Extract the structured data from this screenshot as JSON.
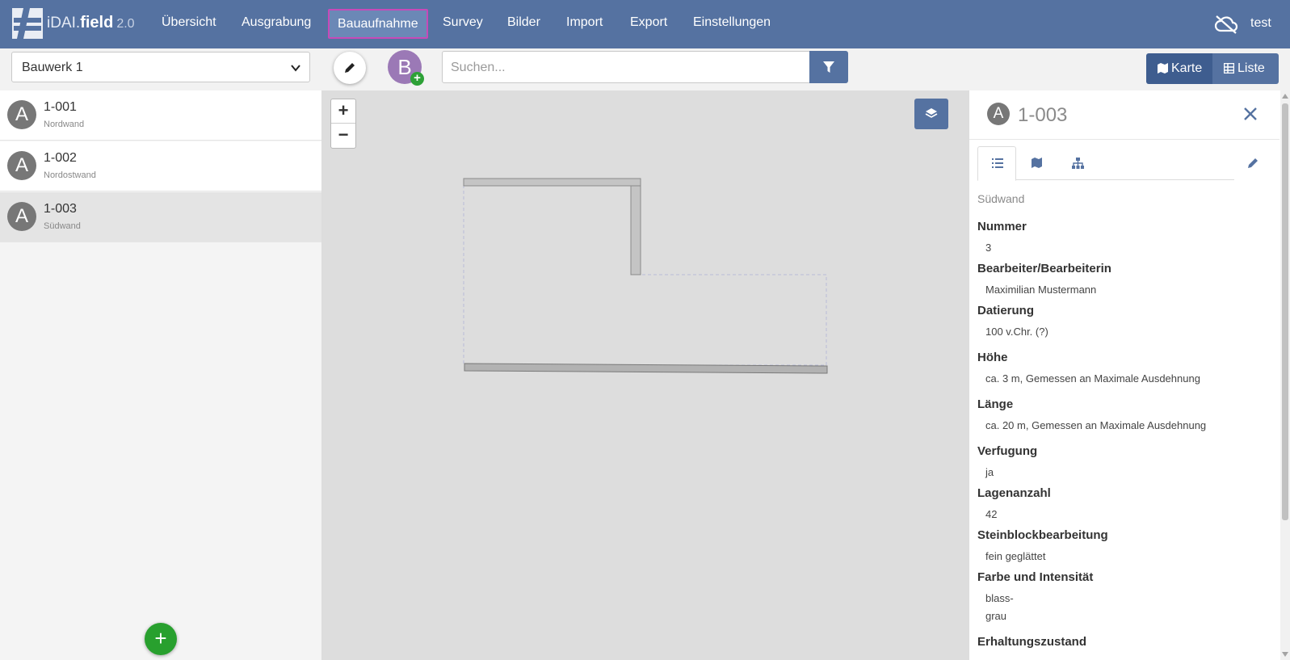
{
  "app": {
    "brand_prefix": "iDAI.",
    "brand_name": "field",
    "version": "2.0",
    "user": "test"
  },
  "nav": {
    "items": [
      {
        "label": "Übersicht"
      },
      {
        "label": "Ausgrabung"
      },
      {
        "label": "Bauaufnahme",
        "active": true
      },
      {
        "label": "Survey"
      },
      {
        "label": "Bilder"
      },
      {
        "label": "Import"
      },
      {
        "label": "Export"
      },
      {
        "label": "Einstellungen"
      }
    ]
  },
  "toolbar": {
    "operation_select": "Bauwerk 1",
    "create_letter": "B",
    "search_placeholder": "Suchen...",
    "view_karte": "Karte",
    "view_liste": "Liste"
  },
  "list": {
    "items": [
      {
        "avatar": "A",
        "id": "1-001",
        "sub": "Nordwand"
      },
      {
        "avatar": "A",
        "id": "1-002",
        "sub": "Nordostwand"
      },
      {
        "avatar": "A",
        "id": "1-003",
        "sub": "Südwand",
        "selected": true
      }
    ],
    "add_label": "+"
  },
  "map": {
    "zoom_in": "+",
    "zoom_out": "−"
  },
  "detail": {
    "avatar": "A",
    "title": "1-003",
    "category": "Südwand",
    "fields": [
      {
        "label": "Nummer",
        "values": [
          "3"
        ]
      },
      {
        "label": "Bearbeiter/Bearbeiterin",
        "values": [
          "Maximilian Mustermann"
        ]
      },
      {
        "label": "Datierung",
        "values": [
          "100 v.Chr. (?)"
        ]
      },
      {
        "label": "Höhe",
        "values": [
          "ca. 3 m, Gemessen an Maximale Ausdehnung"
        ]
      },
      {
        "label": "Länge",
        "values": [
          "ca. 20 m, Gemessen an Maximale Ausdehnung"
        ]
      },
      {
        "label": "Verfugung",
        "values": [
          "ja"
        ]
      },
      {
        "label": "Lagenanzahl",
        "values": [
          "42"
        ]
      },
      {
        "label": "Steinblockbearbeitung",
        "values": [
          "fein geglättet"
        ]
      },
      {
        "label": "Farbe und Intensität",
        "values": [
          "blass-",
          "grau"
        ]
      },
      {
        "label": "Erhaltungszustand",
        "values": []
      }
    ]
  },
  "colors": {
    "navbar": "#5572a1",
    "active_outline": "#c74ab8",
    "add_green": "#28a02e",
    "create_purple": "#9b79b6"
  }
}
